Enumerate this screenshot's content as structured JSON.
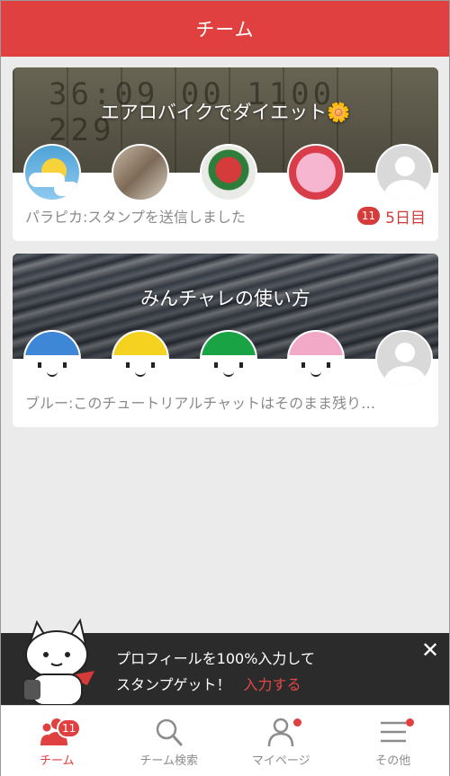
{
  "header": {
    "title": "チーム"
  },
  "teams": [
    {
      "title": "エアロバイクでダイエット🌼",
      "photo_digits": "36:09 00 1100 229",
      "last_message": "パラピカ:スタンプを送信しました",
      "unread_count": "11",
      "day_label": "5日目",
      "avatars": [
        "sun-cloud",
        "cat-photo",
        "flower-photo",
        "smile-face",
        "blank-user"
      ]
    },
    {
      "title": "みんチャレの使い方",
      "last_message": "ブルー:このチュートリアルチャットはそのまま残り…",
      "avatars": [
        "cat-blue",
        "cat-yellow",
        "cat-green",
        "cat-pink",
        "blank-user"
      ]
    }
  ],
  "promo": {
    "line1": "プロフィールを100%入力して",
    "line2": "スタンプゲット！",
    "link": "入力する",
    "close": "✕"
  },
  "tabbar": {
    "items": [
      {
        "label": "チーム",
        "icon": "team-icon",
        "badge": "11",
        "active": true
      },
      {
        "label": "チーム検索",
        "icon": "search-icon"
      },
      {
        "label": "マイページ",
        "icon": "person-icon",
        "dot": true
      },
      {
        "label": "その他",
        "icon": "menu-icon",
        "dot": true
      }
    ]
  },
  "colors": {
    "accent": "#e0403f",
    "background": "#ebebeb",
    "promo_bg": "#2b2b2b"
  }
}
